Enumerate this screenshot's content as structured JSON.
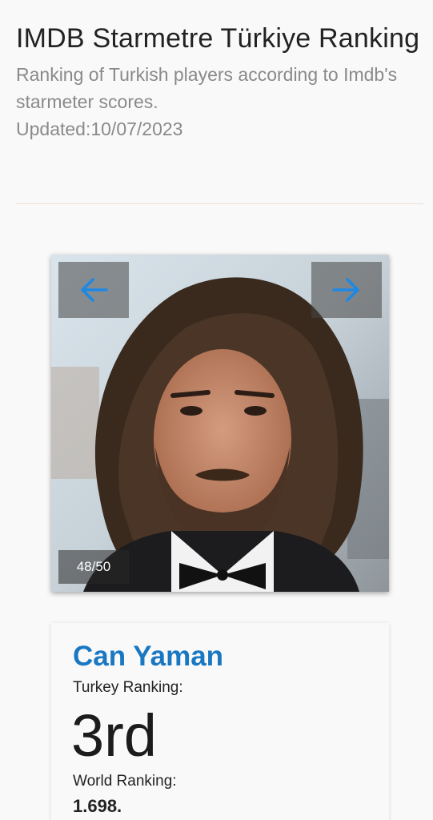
{
  "header": {
    "title": "IMDB Starmetre Türkiye Ranking",
    "subtitle": "Ranking of Turkish players according to Imdb's starmeter scores.",
    "updated": "Updated:10/07/2023"
  },
  "carousel": {
    "prev_icon": "arrow-left-icon",
    "next_icon": "arrow-right-icon",
    "counter": "48/50",
    "arrow_color": "#1e88e5"
  },
  "card": {
    "name": "Can Yaman",
    "turkey_label": "Turkey Ranking:",
    "turkey_rank": "3rd",
    "world_label": "World Ranking:",
    "world_rank": "1.698.",
    "name_color": "#1a78c2"
  }
}
